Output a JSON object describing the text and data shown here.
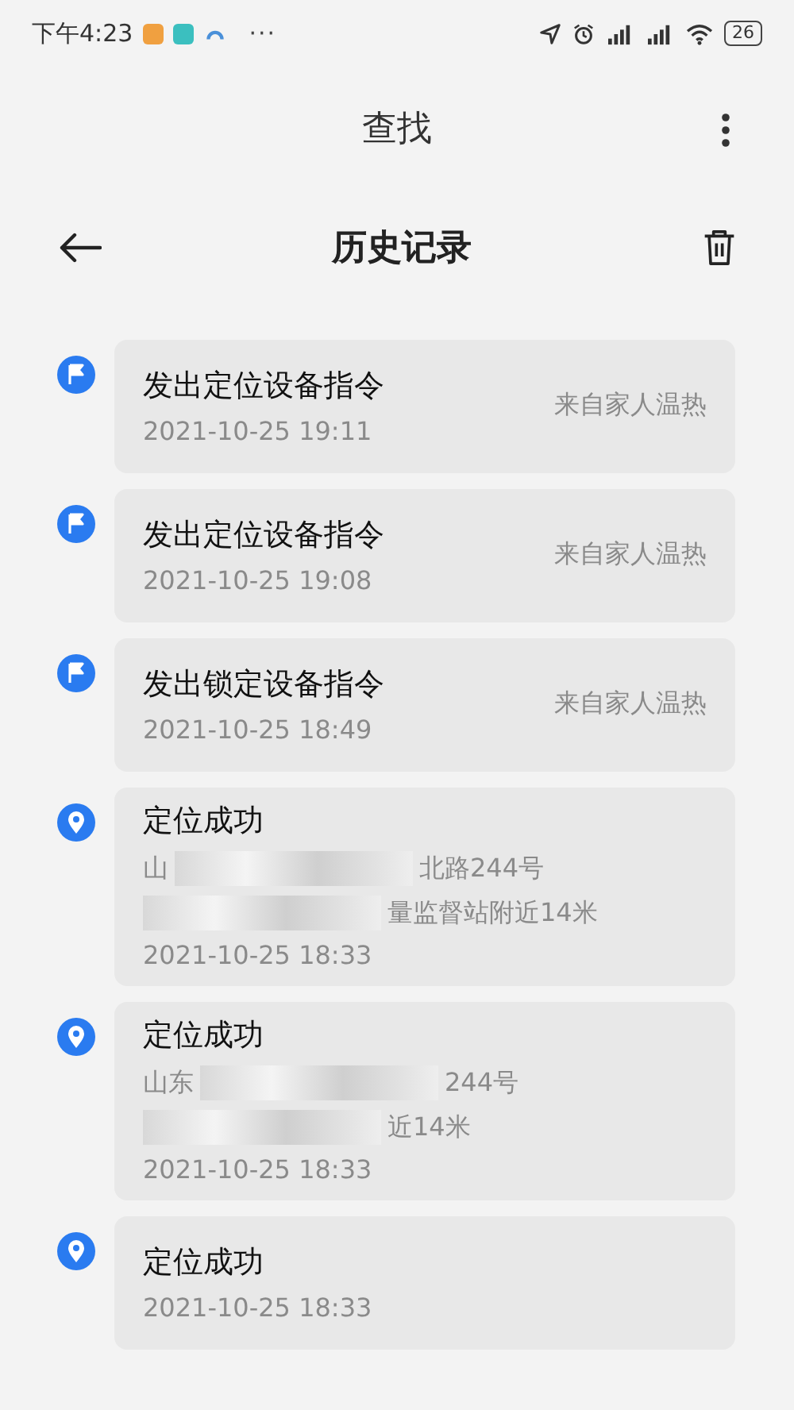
{
  "status_bar": {
    "time": "下午4:23",
    "more": "···",
    "battery": "26"
  },
  "app_bar": {
    "title": "查找"
  },
  "nav": {
    "title": "历史记录"
  },
  "records": [
    {
      "kind": "flag",
      "title": "发出定位设备指令",
      "time": "2021-10-25 19:11",
      "source": "来自家人温热"
    },
    {
      "kind": "flag",
      "title": "发出定位设备指令",
      "time": "2021-10-25 19:08",
      "source": "来自家人温热"
    },
    {
      "kind": "flag",
      "title": "发出锁定设备指令",
      "time": "2021-10-25 18:49",
      "source": "来自家人温热"
    },
    {
      "kind": "pin",
      "title": "定位成功",
      "address_lines": [
        [
          {
            "kind": "text",
            "text": "山"
          },
          {
            "kind": "redacted"
          },
          {
            "kind": "text",
            "text": "北路244号"
          }
        ],
        [
          {
            "kind": "redacted"
          },
          {
            "kind": "text",
            "text": "量监督站附近14米"
          }
        ]
      ],
      "time": "2021-10-25 18:33"
    },
    {
      "kind": "pin",
      "title": "定位成功",
      "address_lines": [
        [
          {
            "kind": "text",
            "text": "山东"
          },
          {
            "kind": "redacted"
          },
          {
            "kind": "text",
            "text": "244号"
          }
        ],
        [
          {
            "kind": "redacted"
          },
          {
            "kind": "text",
            "text": "近14米"
          }
        ]
      ],
      "time": "2021-10-25 18:33"
    },
    {
      "kind": "pin",
      "title": "定位成功",
      "time": "2021-10-25 18:33"
    }
  ]
}
